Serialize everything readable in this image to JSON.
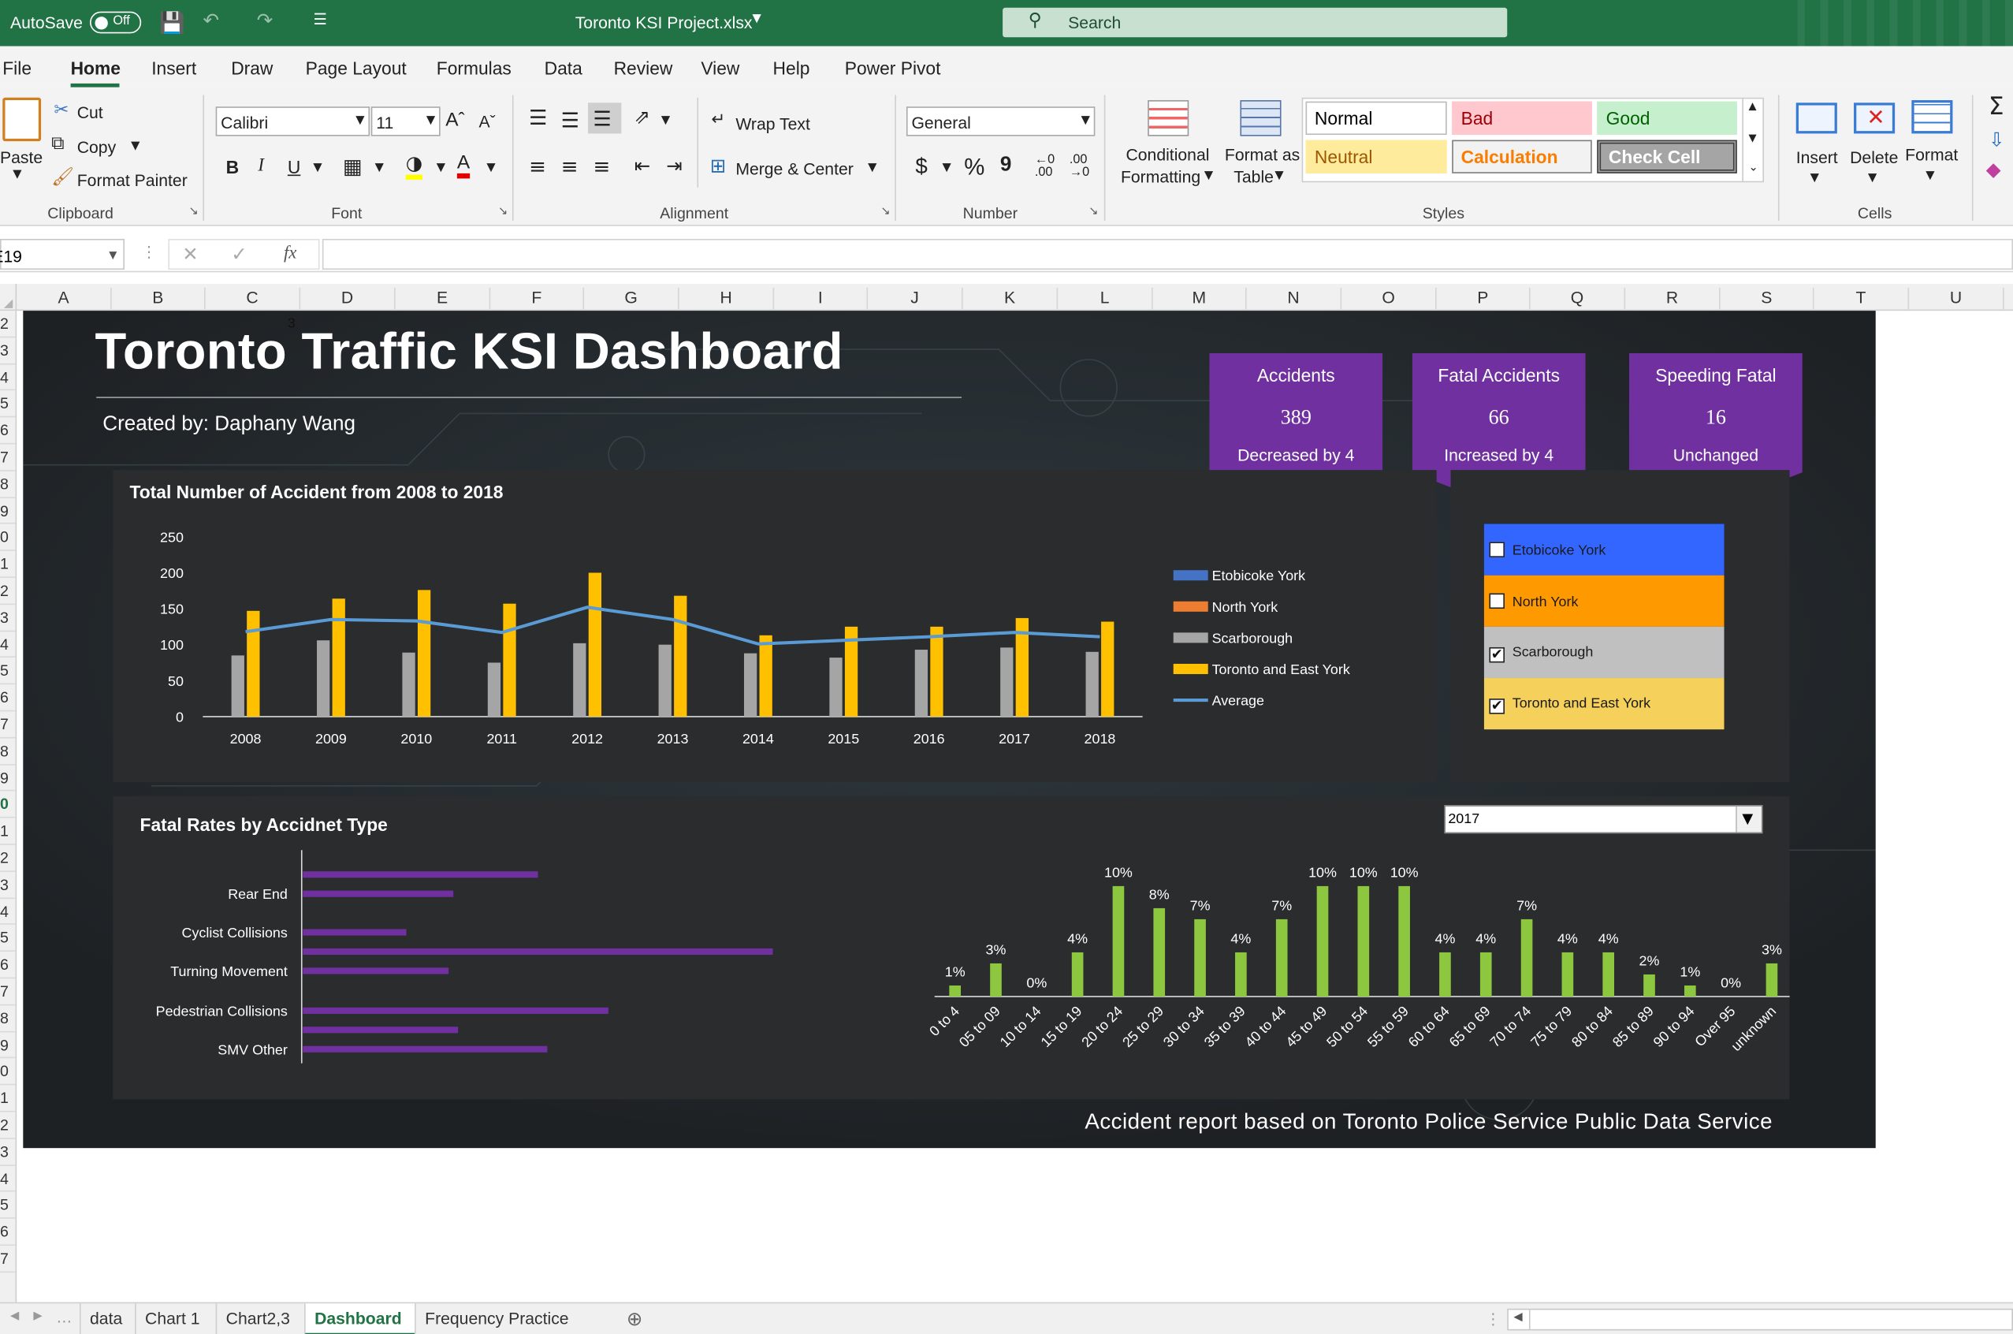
{
  "titlebar": {
    "autosave_label": "AutoSave",
    "autosave_state": "Off",
    "filename": "Toronto KSI Project.xlsx",
    "search_placeholder": "Search"
  },
  "menu": [
    "File",
    "Home",
    "Insert",
    "Draw",
    "Page Layout",
    "Formulas",
    "Data",
    "Review",
    "View",
    "Help",
    "Power Pivot"
  ],
  "ribbon": {
    "clipboard": {
      "paste": "Paste",
      "cut": "Cut",
      "copy": "Copy",
      "format_painter": "Format Painter",
      "group": "Clipboard"
    },
    "font": {
      "name": "Calibri",
      "size": "11",
      "group": "Font"
    },
    "alignment": {
      "wrap": "Wrap Text",
      "merge": "Merge & Center",
      "group": "Alignment"
    },
    "number": {
      "format": "General",
      "group": "Number",
      "currency": "$",
      "percent": "%",
      "comma": "9"
    },
    "styles": {
      "conditional": "Conditional",
      "formatting": "Formatting",
      "format_as": "Format as",
      "table": "Table",
      "normal": "Normal",
      "bad": "Bad",
      "good": "Good",
      "neutral": "Neutral",
      "calculation": "Calculation",
      "check": "Check Cell",
      "group": "Styles"
    },
    "cells": {
      "insert": "Insert",
      "delete": "Delete",
      "format": "Format",
      "group": "Cells"
    }
  },
  "formula_bar": {
    "cell_ref": "E19",
    "fx": "fx"
  },
  "columns": [
    "A",
    "B",
    "C",
    "D",
    "E",
    "F",
    "G",
    "H",
    "I",
    "J",
    "K",
    "L",
    "M",
    "N",
    "O",
    "P",
    "Q",
    "R",
    "S",
    "T",
    "U"
  ],
  "rows": [
    "2",
    "3",
    "4",
    "5",
    "6",
    "7",
    "8",
    "9",
    "0",
    "1",
    "2",
    "3",
    "4",
    "5",
    "6",
    "7",
    "8",
    "9",
    "0",
    "1",
    "2",
    "3",
    "4",
    "5",
    "6",
    "7",
    "8",
    "9",
    "0",
    "1",
    "2",
    "3",
    "4",
    "5",
    "6",
    "7"
  ],
  "dashboard": {
    "title": "Toronto Traffic KSI Dashboard",
    "stray_mark": "3",
    "created_by": "Created by: Daphany Wang",
    "footer": "Accident report based on Toronto Police Service Public Data Service",
    "kpis": [
      {
        "label": "Accidents",
        "value": "389",
        "change": "Decreased by 4"
      },
      {
        "label": "Fatal Accidents",
        "value": "66",
        "change": "Increased by 4"
      },
      {
        "label": "Speeding Fatal",
        "value": "16",
        "change": "Unchanged"
      }
    ],
    "slicer": [
      {
        "label": "Etobicoke York",
        "checked": false,
        "color": "#3366ff",
        "text": "#1a1a1a"
      },
      {
        "label": "North York",
        "checked": false,
        "color": "#ff9900",
        "text": "#1a1a1a"
      },
      {
        "label": "Scarborough",
        "checked": true,
        "color": "#c0c0c0",
        "text": "#1a1a1a"
      },
      {
        "label": "Toronto and East York",
        "checked": true,
        "color": "#f5d05a",
        "text": "#1a1a1a"
      }
    ],
    "year_dropdown": "2017"
  },
  "sheet_tabs": [
    {
      "label": "data",
      "active": false
    },
    {
      "label": "Chart 1",
      "active": false
    },
    {
      "label": "Chart2,3",
      "active": false
    },
    {
      "label": "Dashboard",
      "active": true
    },
    {
      "label": "Frequency Practice",
      "active": false
    }
  ],
  "chart_data": [
    {
      "type": "bar",
      "title": "Total Number of Accident from 2008 to 2018",
      "categories": [
        "2008",
        "2009",
        "2010",
        "2011",
        "2012",
        "2013",
        "2014",
        "2015",
        "2016",
        "2017",
        "2018"
      ],
      "ylim": [
        0,
        250
      ],
      "yticks": [
        0,
        50,
        100,
        150,
        200,
        250
      ],
      "legend_position": "right",
      "series": [
        {
          "name": "Etobicoke York",
          "color": "#4472c4",
          "values": [
            0,
            0,
            0,
            0,
            0,
            0,
            0,
            0,
            0,
            0,
            0
          ]
        },
        {
          "name": "North York",
          "color": "#ed7d31",
          "values": [
            0,
            0,
            0,
            0,
            0,
            0,
            0,
            0,
            0,
            0,
            0
          ]
        },
        {
          "name": "Scarborough",
          "color": "#a5a5a5",
          "values": [
            85,
            106,
            89,
            75,
            102,
            100,
            88,
            82,
            93,
            96,
            90
          ]
        },
        {
          "name": "Toronto and East York",
          "color": "#ffc000",
          "values": [
            147,
            164,
            176,
            157,
            200,
            168,
            113,
            125,
            125,
            137,
            132
          ]
        },
        {
          "name": "Average",
          "color": "#5b9bd5",
          "kind": "line",
          "values": [
            118,
            135,
            133,
            117,
            152,
            135,
            101,
            106,
            111,
            117,
            111
          ]
        }
      ]
    },
    {
      "type": "bar",
      "orientation": "horizontal",
      "title": "Fatal Rates by Accidnet Type",
      "categories": [
        "Rear End",
        "Cyclist Collisions",
        "Turning Movement",
        "Pedestrian Collisions",
        "SMV Other"
      ],
      "color": "#7030a0",
      "values_relative": [
        0.5,
        0.32,
        0.22,
        1.0,
        0.31,
        0.65,
        0.33,
        0.52
      ],
      "bar_categories": [
        "Rear End",
        "Rear End",
        "Cyclist Collisions",
        "Cyclist Collisions",
        "Turning Movement",
        "Pedestrian Collisions",
        "Pedestrian Collisions",
        "SMV Other"
      ]
    },
    {
      "type": "bar",
      "title": "",
      "color": "#8dc63f",
      "categories": [
        "0 to 4",
        "05 to 09",
        "10 to 14",
        "15 to 19",
        "20 to 24",
        "25 to 29",
        "30 to 34",
        "35 to 39",
        "40 to 44",
        "45 to 49",
        "50 to 54",
        "55 to 59",
        "60 to 64",
        "65 to 69",
        "70 to 74",
        "75 to 79",
        "80 to 84",
        "85 to 89",
        "90 to 94",
        "Over 95",
        "unknown"
      ],
      "values": [
        1,
        3,
        0,
        4,
        10,
        8,
        7,
        4,
        7,
        10,
        10,
        10,
        4,
        4,
        7,
        4,
        4,
        2,
        1,
        0,
        3
      ],
      "labels": [
        "1%",
        "3%",
        "0%",
        "4%",
        "10%",
        "8%",
        "7%",
        "4%",
        "7%",
        "10%",
        "10%",
        "10%",
        "4%",
        "4%",
        "7%",
        "4%",
        "4%",
        "2%",
        "1%",
        "0%",
        "3%"
      ],
      "ylim": [
        0,
        10
      ]
    }
  ]
}
